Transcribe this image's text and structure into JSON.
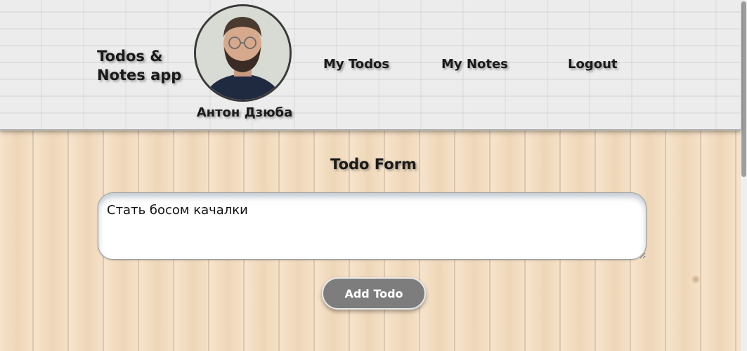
{
  "header": {
    "brand": "Todos & Notes app",
    "user_name": "Антон Дзюба",
    "nav": {
      "todos": "My Todos",
      "notes": "My Notes",
      "logout": "Logout"
    }
  },
  "form": {
    "title": "Todo Form",
    "input_value": "Стать босом качалки",
    "submit_label": "Add Todo"
  },
  "colors": {
    "button_bg": "#7d7d7d",
    "header_bg": "#ececec",
    "main_bg": "#f3ddc1"
  }
}
